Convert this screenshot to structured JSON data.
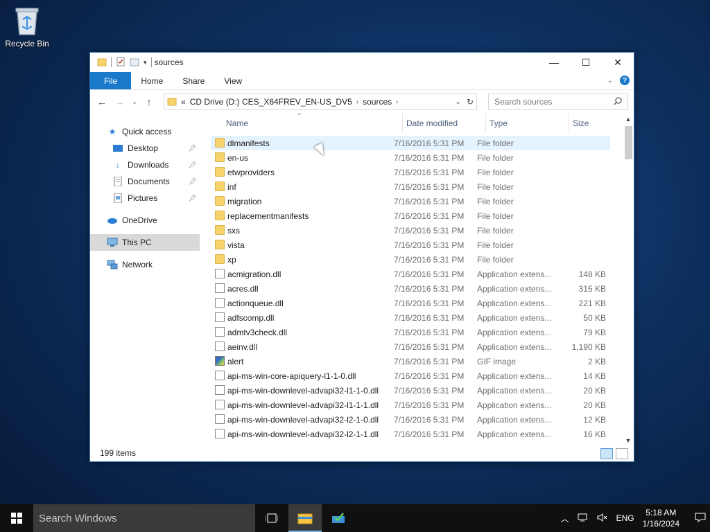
{
  "desktop": {
    "recycle_bin_label": "Recycle Bin"
  },
  "window": {
    "title": "sources",
    "ribbon_tabs": [
      "File",
      "Home",
      "Share",
      "View"
    ],
    "address": {
      "overflow": "«",
      "crumbs": [
        "CD Drive (D:) CES_X64FREV_EN-US_DV5",
        "sources"
      ]
    },
    "search_placeholder": "Search sources",
    "columns": {
      "name": "Name",
      "date": "Date modified",
      "type": "Type",
      "size": "Size"
    },
    "status_text": "199 items"
  },
  "nav_pane": {
    "quick_access": "Quick access",
    "desktop": "Desktop",
    "downloads": "Downloads",
    "documents": "Documents",
    "pictures": "Pictures",
    "onedrive": "OneDrive",
    "this_pc": "This PC",
    "network": "Network"
  },
  "files": [
    {
      "name": "dlmanifests",
      "date": "7/16/2016 5:31 PM",
      "type": "File folder",
      "size": "",
      "icon": "folder-icon"
    },
    {
      "name": "en-us",
      "date": "7/16/2016 5:31 PM",
      "type": "File folder",
      "size": "",
      "icon": "folder-icon"
    },
    {
      "name": "etwproviders",
      "date": "7/16/2016 5:31 PM",
      "type": "File folder",
      "size": "",
      "icon": "folder-icon"
    },
    {
      "name": "inf",
      "date": "7/16/2016 5:31 PM",
      "type": "File folder",
      "size": "",
      "icon": "folder-icon"
    },
    {
      "name": "migration",
      "date": "7/16/2016 5:31 PM",
      "type": "File folder",
      "size": "",
      "icon": "folder-icon"
    },
    {
      "name": "replacementmanifests",
      "date": "7/16/2016 5:31 PM",
      "type": "File folder",
      "size": "",
      "icon": "folder-icon"
    },
    {
      "name": "sxs",
      "date": "7/16/2016 5:31 PM",
      "type": "File folder",
      "size": "",
      "icon": "folder-icon"
    },
    {
      "name": "vista",
      "date": "7/16/2016 5:31 PM",
      "type": "File folder",
      "size": "",
      "icon": "folder-icon"
    },
    {
      "name": "xp",
      "date": "7/16/2016 5:31 PM",
      "type": "File folder",
      "size": "",
      "icon": "folder-icon"
    },
    {
      "name": "acmigration.dll",
      "date": "7/16/2016 5:31 PM",
      "type": "Application extens...",
      "size": "148 KB",
      "icon": "dll-file-icon"
    },
    {
      "name": "acres.dll",
      "date": "7/16/2016 5:31 PM",
      "type": "Application extens...",
      "size": "315 KB",
      "icon": "dll-file-icon"
    },
    {
      "name": "actionqueue.dll",
      "date": "7/16/2016 5:31 PM",
      "type": "Application extens...",
      "size": "221 KB",
      "icon": "dll-file-icon"
    },
    {
      "name": "adfscomp.dll",
      "date": "7/16/2016 5:31 PM",
      "type": "Application extens...",
      "size": "50 KB",
      "icon": "dll-file-icon"
    },
    {
      "name": "admtv3check.dll",
      "date": "7/16/2016 5:31 PM",
      "type": "Application extens...",
      "size": "79 KB",
      "icon": "dll-file-icon"
    },
    {
      "name": "aeinv.dll",
      "date": "7/16/2016 5:31 PM",
      "type": "Application extens...",
      "size": "1,190 KB",
      "icon": "dll-file-icon"
    },
    {
      "name": "alert",
      "date": "7/16/2016 5:31 PM",
      "type": "GIF image",
      "size": "2 KB",
      "icon": "gif-image-icon"
    },
    {
      "name": "api-ms-win-core-apiquery-l1-1-0.dll",
      "date": "7/16/2016 5:31 PM",
      "type": "Application extens...",
      "size": "14 KB",
      "icon": "dll-file-icon"
    },
    {
      "name": "api-ms-win-downlevel-advapi32-l1-1-0.dll",
      "date": "7/16/2016 5:31 PM",
      "type": "Application extens...",
      "size": "20 KB",
      "icon": "dll-file-icon"
    },
    {
      "name": "api-ms-win-downlevel-advapi32-l1-1-1.dll",
      "date": "7/16/2016 5:31 PM",
      "type": "Application extens...",
      "size": "20 KB",
      "icon": "dll-file-icon"
    },
    {
      "name": "api-ms-win-downlevel-advapi32-l2-1-0.dll",
      "date": "7/16/2016 5:31 PM",
      "type": "Application extens...",
      "size": "12 KB",
      "icon": "dll-file-icon"
    },
    {
      "name": "api-ms-win-downlevel-advapi32-l2-1-1.dll",
      "date": "7/16/2016 5:31 PM",
      "type": "Application extens...",
      "size": "16 KB",
      "icon": "dll-file-icon"
    }
  ],
  "taskbar": {
    "search_placeholder": "Search Windows",
    "language": "ENG",
    "time": "5:18 AM",
    "date": "1/16/2024"
  },
  "colors": {
    "accent": "#1979ca",
    "hover_row": "#e5f3ff",
    "selected_nav": "#d9d9d9"
  }
}
